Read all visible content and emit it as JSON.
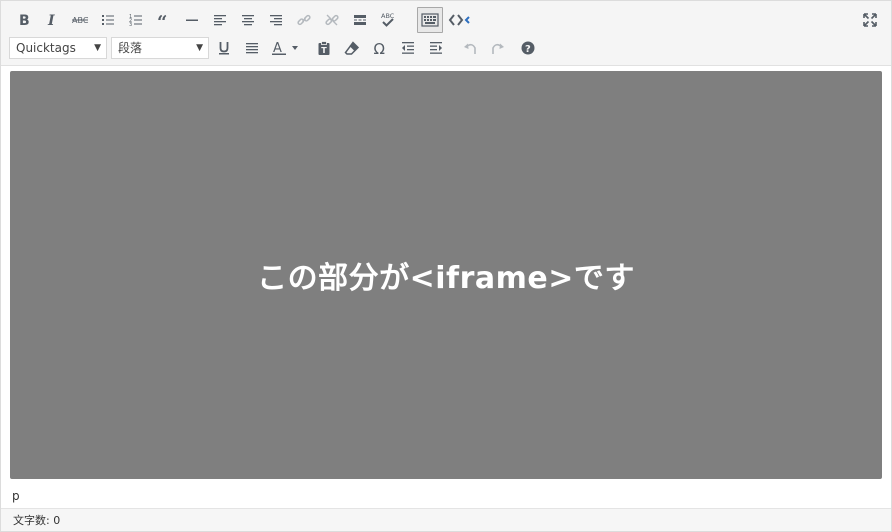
{
  "toolbar": {
    "row1": [
      {
        "name": "bold-button",
        "icon": "bold-icon"
      },
      {
        "name": "italic-button",
        "icon": "italic-icon"
      },
      {
        "name": "strikethrough-button",
        "icon": "strikethrough-icon"
      },
      {
        "name": "bullet-list-button",
        "icon": "bullet-list-icon"
      },
      {
        "name": "numbered-list-button",
        "icon": "numbered-list-icon"
      },
      {
        "name": "blockquote-button",
        "icon": "blockquote-icon"
      },
      {
        "name": "horizontal-line-button",
        "icon": "horizontal-line-icon"
      },
      {
        "name": "align-left-button",
        "icon": "align-left-icon"
      },
      {
        "name": "align-center-button",
        "icon": "align-center-icon"
      },
      {
        "name": "align-right-button",
        "icon": "align-right-icon"
      },
      {
        "name": "insert-link-button",
        "icon": "link-icon"
      },
      {
        "name": "remove-link-button",
        "icon": "unlink-icon"
      },
      {
        "name": "read-more-button",
        "icon": "read-more-icon"
      },
      {
        "name": "spellcheck-button",
        "icon": "spellcheck-icon"
      },
      {
        "name": "toolbar-toggle-button",
        "icon": "keyboard-icon"
      },
      {
        "name": "code-button",
        "icon": "code-icon"
      }
    ],
    "spellcheck_glyph": "ABC",
    "fullscreen_icon": "fullscreen-icon",
    "quicktags_select": "Quicktags",
    "format_select": "段落",
    "row2": [
      {
        "name": "underline-button",
        "icon": "underline-icon"
      },
      {
        "name": "justify-button",
        "icon": "justify-icon"
      },
      {
        "name": "text-color-button",
        "icon": "text-color-icon"
      },
      {
        "name": "paste-text-button",
        "icon": "paste-text-icon"
      },
      {
        "name": "clear-formatting-button",
        "icon": "eraser-icon"
      },
      {
        "name": "special-character-button",
        "icon": "omega-icon"
      },
      {
        "name": "outdent-button",
        "icon": "outdent-icon"
      },
      {
        "name": "indent-button",
        "icon": "indent-icon"
      },
      {
        "name": "undo-button",
        "icon": "undo-icon"
      },
      {
        "name": "redo-button",
        "icon": "redo-icon"
      },
      {
        "name": "help-button",
        "icon": "help-icon"
      }
    ],
    "colors": {
      "icon": "#555d66",
      "disabled_icon": "#b4b9be",
      "code_accent": "#2e6fbf"
    }
  },
  "content": {
    "text": "この部分が<iframe>です",
    "background": "#7f7f7f"
  },
  "path": "p",
  "status": {
    "word_count": "文字数: 0"
  }
}
